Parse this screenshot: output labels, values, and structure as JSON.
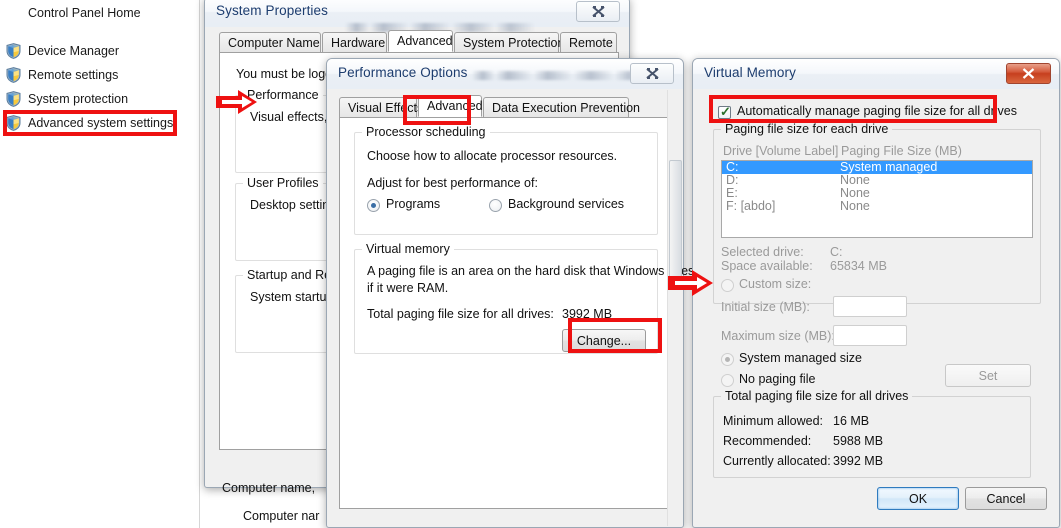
{
  "sidebar": {
    "home_label": "Control Panel Home",
    "items": [
      {
        "label": "Device Manager"
      },
      {
        "label": "Remote settings"
      },
      {
        "label": "System protection"
      },
      {
        "label": "Advanced system settings"
      }
    ]
  },
  "system_properties": {
    "title": "System Properties",
    "close_label": "✖",
    "tabs": [
      {
        "label": "Computer Name"
      },
      {
        "label": "Hardware"
      },
      {
        "label": "Advanced"
      },
      {
        "label": "System Protection"
      },
      {
        "label": "Remote"
      }
    ],
    "active_tab": "Advanced",
    "logon_note": "You must be logg",
    "performance_group": "Performance",
    "performance_desc": "Visual effects, p",
    "user_profiles_group": "User Profiles",
    "user_profiles_desc": "Desktop setting",
    "startup_group": "Startup and Rec",
    "startup_desc": "System startup,",
    "below_line_1": "Computer name,",
    "below_line_2": "Computer nar"
  },
  "performance_options": {
    "title": "Performance Options",
    "close_label": "✖",
    "tabs": [
      {
        "label": "Visual Effects"
      },
      {
        "label": "Advanced"
      },
      {
        "label": "Data Execution Prevention"
      }
    ],
    "active_tab": "Advanced",
    "processor_group": "Processor scheduling",
    "processor_desc": "Choose how to allocate processor resources.",
    "adjust_label": "Adjust for best performance of:",
    "radio_programs": "Programs",
    "radio_background": "Background services",
    "selected_scheduling": "Programs",
    "virtual_memory_group": "Virtual memory",
    "vm_desc_line1": "A paging file is an area on the hard disk that Windows uses as",
    "vm_desc_line2": "if it were RAM.",
    "total_label": "Total paging file size for all drives:",
    "total_value": "3992 MB",
    "change_button": "Change..."
  },
  "virtual_memory": {
    "title": "Virtual Memory",
    "close_label": "✖",
    "auto_manage_label": "Automatically manage paging file size for all drives",
    "auto_manage_checked": true,
    "paging_group": "Paging file size for each drive",
    "col_drive": "Drive  [Volume Label]",
    "col_size": "Paging File Size (MB)",
    "drives": [
      {
        "drive": "C:",
        "size": "System managed",
        "selected": true
      },
      {
        "drive": "D:",
        "size": "None",
        "selected": false
      },
      {
        "drive": "E:",
        "size": "None",
        "selected": false
      },
      {
        "drive": "F:       [abdo]",
        "size": "None",
        "selected": false
      }
    ],
    "selected_drive_label": "Selected drive:",
    "selected_drive_value": "C:",
    "space_available_label": "Space available:",
    "space_available_value": "65834 MB",
    "custom_size_label": "Custom size:",
    "initial_size_label": "Initial size (MB):",
    "initial_size_value": "",
    "maximum_size_label": "Maximum size (MB):",
    "maximum_size_value": "",
    "system_managed_label": "System managed size",
    "no_paging_label": "No paging file",
    "selected_option": "System managed size",
    "set_button": "Set",
    "total_group": "Total paging file size for all drives",
    "minimum_label": "Minimum allowed:",
    "minimum_value": "16 MB",
    "recommended_label": "Recommended:",
    "recommended_value": "5988 MB",
    "allocated_label": "Currently allocated:",
    "allocated_value": "3992 MB",
    "ok_button": "OK",
    "cancel_button": "Cancel"
  },
  "annotations": {
    "highlight_color": "#ee1111",
    "arrow_color": "#ee1111",
    "boxes": [
      "advanced-system-settings",
      "performance-options-advanced-tab",
      "change-button",
      "auto-manage-checkbox"
    ],
    "arrows": [
      "arrow-to-performance",
      "arrow-to-custom-size"
    ]
  }
}
